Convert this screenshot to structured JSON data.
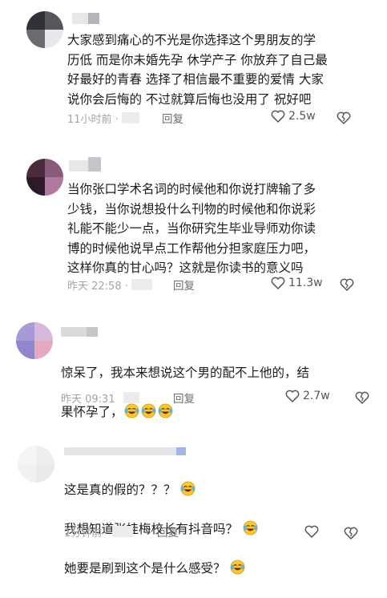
{
  "comments": [
    {
      "text": "大家感到痛心的不光是你选择这个男朋友的学\n历低 而是你未婚先孕 休学产子 你放弃了自己最\n好最好的青春 选择了相信最不重要的爱情 大家\n说你会后悔的 不过就算后悔也没用了 祝好吧",
      "time": "11小时前 ·",
      "reply": "回复",
      "likes": "2.5w"
    },
    {
      "text": "当你张口学术名词的时候他和你说打牌输了多\n少钱，当你说想投什么刊物的时候他和你说彩\n礼能不能少一点，当你研究生毕业导师劝你读\n博的时候他说早点工作帮他分担家庭压力吧，\n这样你真的甘心吗？这就是你读书的意义吗",
      "time": "昨天 22:58 ·",
      "reply": "回复",
      "likes": "11.3w"
    },
    {
      "line1": "惊呆了，我本来想说这个男的配不上他的，结",
      "line2": "果怀孕了，",
      "time": "昨天 09:31",
      "reply": "回复",
      "likes": "2.7w"
    },
    {
      "line1": "这是真的假的？？？",
      "line2": "我想知道张桂梅校长有抖音吗？",
      "line3": "她要是刷到这个是什么感受？",
      "time": "1分钟前 ·",
      "reply": "回复",
      "likes": ""
    }
  ],
  "icons": [
    "heart-icon",
    "broken-heart-icon",
    "laughing-crying-emoji"
  ]
}
